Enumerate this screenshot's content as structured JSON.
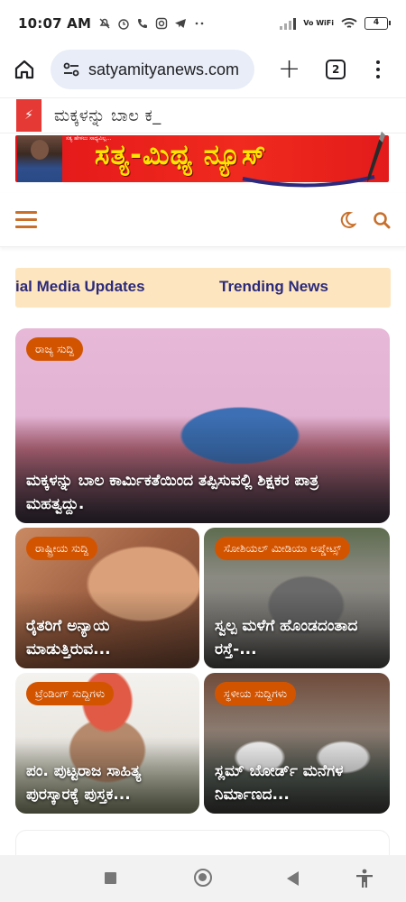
{
  "status_bar": {
    "time": "10:07 AM",
    "left_icons": [
      "mute-icon",
      "alarm-icon",
      "call-icon",
      "instagram-icon",
      "telegram-icon",
      "more-icon"
    ],
    "network_label": "Vo WiFi",
    "battery": "4"
  },
  "browser": {
    "url": "satyamityanews.com",
    "tab_count": "2"
  },
  "ticker": {
    "text": "ಮಕ್ಕಳನ್ನು ಬಾಲ ಕ_"
  },
  "banner": {
    "title": "ಸತ್ಯ-ಮಿಥ್ಯ ನ್ಯೂಸ್",
    "tagline": "ಸತ್ಯ ಹೇಳಲು ಸಾಧ್ಯವಿಲ್ಲ..."
  },
  "category_tabs": [
    "ial Media Updates",
    "Trending News"
  ],
  "cards": [
    {
      "badge": "ರಾಜ್ಯ ಸುದ್ದಿ",
      "title": "ಮಕ್ಕಳನ್ನು ಬಾಲ ಕಾರ್ಮಿಕತೆಯಿಂದ ತಪ್ಪಿಸುವಲ್ಲಿ ಶಿಕ್ಷಕರ ಪಾತ್ರ ಮಹತ್ವದ್ದು."
    },
    {
      "badge": "ರಾಷ್ಟ್ರೀಯ ಸುದ್ದಿ",
      "title": "ರೈತರಿಗೆ ಅನ್ಯಾಯ ಮಾಡುತ್ತಿರುವ..."
    },
    {
      "badge": "ಸೋಶಿಯಲ್ ಮೀಡಿಯಾ ಅಪ್ಡೇಟ್ಸ್",
      "title": "ಸ್ವಲ್ಪ ಮಳೆಗೆ ಹೊಂಡದಂತಾದ ರಸ್ತೆ-..."
    },
    {
      "badge": "ಟ್ರೆಂಡಿಂಗ್ ಸುದ್ದಿಗಳು",
      "title": "ಪಂ. ಪುಟ್ಟರಾಜ ಸಾಹಿತ್ಯ ಪುರಸ್ಕಾರಕ್ಕೆ ಪುಸ್ತಕ..."
    },
    {
      "badge": "ಸ್ಥಳೀಯ ಸುದ್ದಿಗಳು",
      "title": "ಸ್ಲಮ್ ಬೋರ್ಡ್ ಮನೆಗಳ ನಿರ್ಮಾಣದ..."
    }
  ],
  "colors": {
    "accent": "#c8702b",
    "badge": "#d35400",
    "banner_red": "#e2161a",
    "banner_text": "#ffe600",
    "tab_bar": "#fde6bf",
    "tab_text": "#2c2a7a"
  }
}
